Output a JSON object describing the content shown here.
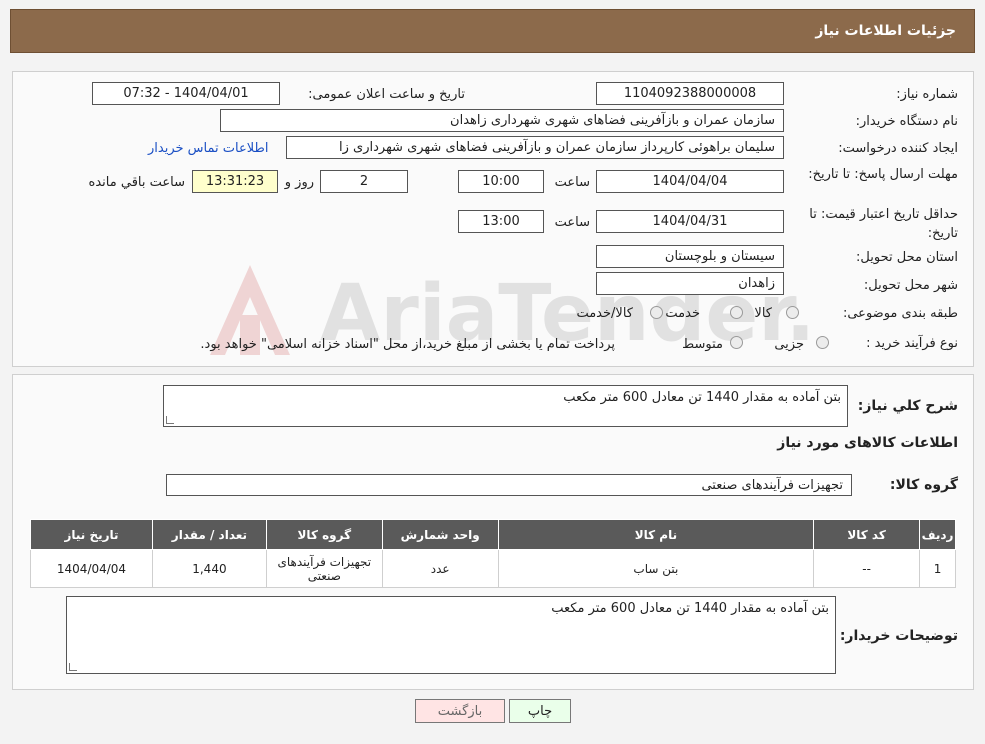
{
  "header": {
    "title": "جزئیات اطلاعات نیاز"
  },
  "watermark": {
    "text": "AriaTender.neT"
  },
  "form": {
    "need_number_label": "شماره نیاز:",
    "need_number": "1104092388000008",
    "announce_label": "تاریخ و ساعت اعلان عمومی:",
    "announce_value": "1404/04/01 - 07:32",
    "buyer_org_label": "نام دستگاه خریدار:",
    "buyer_org": "سازمان عمران و بازآفرینی فضاهای شهری شهرداری زاهدان",
    "requester_label": "ایجاد کننده درخواست:",
    "requester": "سلیمان براهوئی کارپرداز سازمان عمران و بازآفرینی فضاهای شهری شهرداری زا",
    "contact_link": "اطلاعات تماس خریدار",
    "deadline_label": "مهلت ارسال پاسخ: تا تاریخ:",
    "deadline_date": "1404/04/04",
    "time_label": "ساعت",
    "deadline_time": "10:00",
    "days_value": "2",
    "days_label": "روز و",
    "remaining_time": "13:31:23",
    "remaining_label": "ساعت باقي مانده",
    "validity_label": "حداقل تاریخ اعتبار قیمت: تا تاریخ:",
    "validity_date": "1404/04/31",
    "validity_time": "13:00",
    "province_label": "استان محل تحویل:",
    "province": "سیستان و بلوچستان",
    "city_label": "شهر محل تحویل:",
    "city": "زاهدان",
    "category_label": "طبقه بندی موضوعی:",
    "category_options": [
      "کالا",
      "خدمت",
      "کالا/خدمت"
    ],
    "process_label": "نوع فرآیند خرید :",
    "process_options": [
      "جزیی",
      "متوسط"
    ],
    "process_note": "پرداخت تمام یا بخشی از مبلغ خرید،از محل \"اسناد خزانه اسلامی\" خواهد بود."
  },
  "summary": {
    "general_desc_label": "شرح کلي نیاز:",
    "general_desc": "بتن آماده به مقدار 1440 تن معادل 600 متر مکعب",
    "goods_info_title": "اطلاعات کالاهای مورد نیاز",
    "goods_group_label": "گروه کالا:",
    "goods_group": "تجهیزات فرآیندهای صنعتی",
    "table": {
      "headers": [
        "ردیف",
        "کد کالا",
        "نام کالا",
        "واحد شمارش",
        "گروه کالا",
        "تعداد / مقدار",
        "تاریخ نیاز"
      ],
      "rows": [
        [
          "1",
          "--",
          "بتن ساب",
          "عدد",
          "تجهیزات فرآیندهای صنعتی",
          "1,440",
          "1404/04/04"
        ]
      ]
    },
    "buyer_notes_label": "توضیحات خریدار:",
    "buyer_notes": "بتن آماده به مقدار 1440 تن معادل 600 متر مکعب"
  },
  "buttons": {
    "print": "چاپ",
    "back": "بازگشت"
  },
  "colors": {
    "header_bg": "#8c6a4b",
    "print_bg": "#eaffea",
    "back_bg": "#ffe4e4",
    "table_header": "#5a5a5a"
  }
}
